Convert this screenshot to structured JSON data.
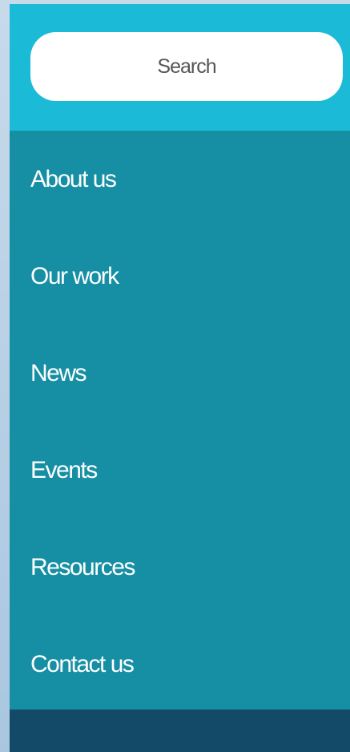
{
  "search": {
    "placeholder": "Search"
  },
  "nav": {
    "items": [
      {
        "label": "About us"
      },
      {
        "label": "Our work"
      },
      {
        "label": "News"
      },
      {
        "label": "Events"
      },
      {
        "label": "Resources"
      },
      {
        "label": "Contact us"
      }
    ]
  },
  "colors": {
    "search_bar": "#1bbad6",
    "menu_background": "#168fa4",
    "footer_bar": "#134a68",
    "text": "#ffffff"
  }
}
